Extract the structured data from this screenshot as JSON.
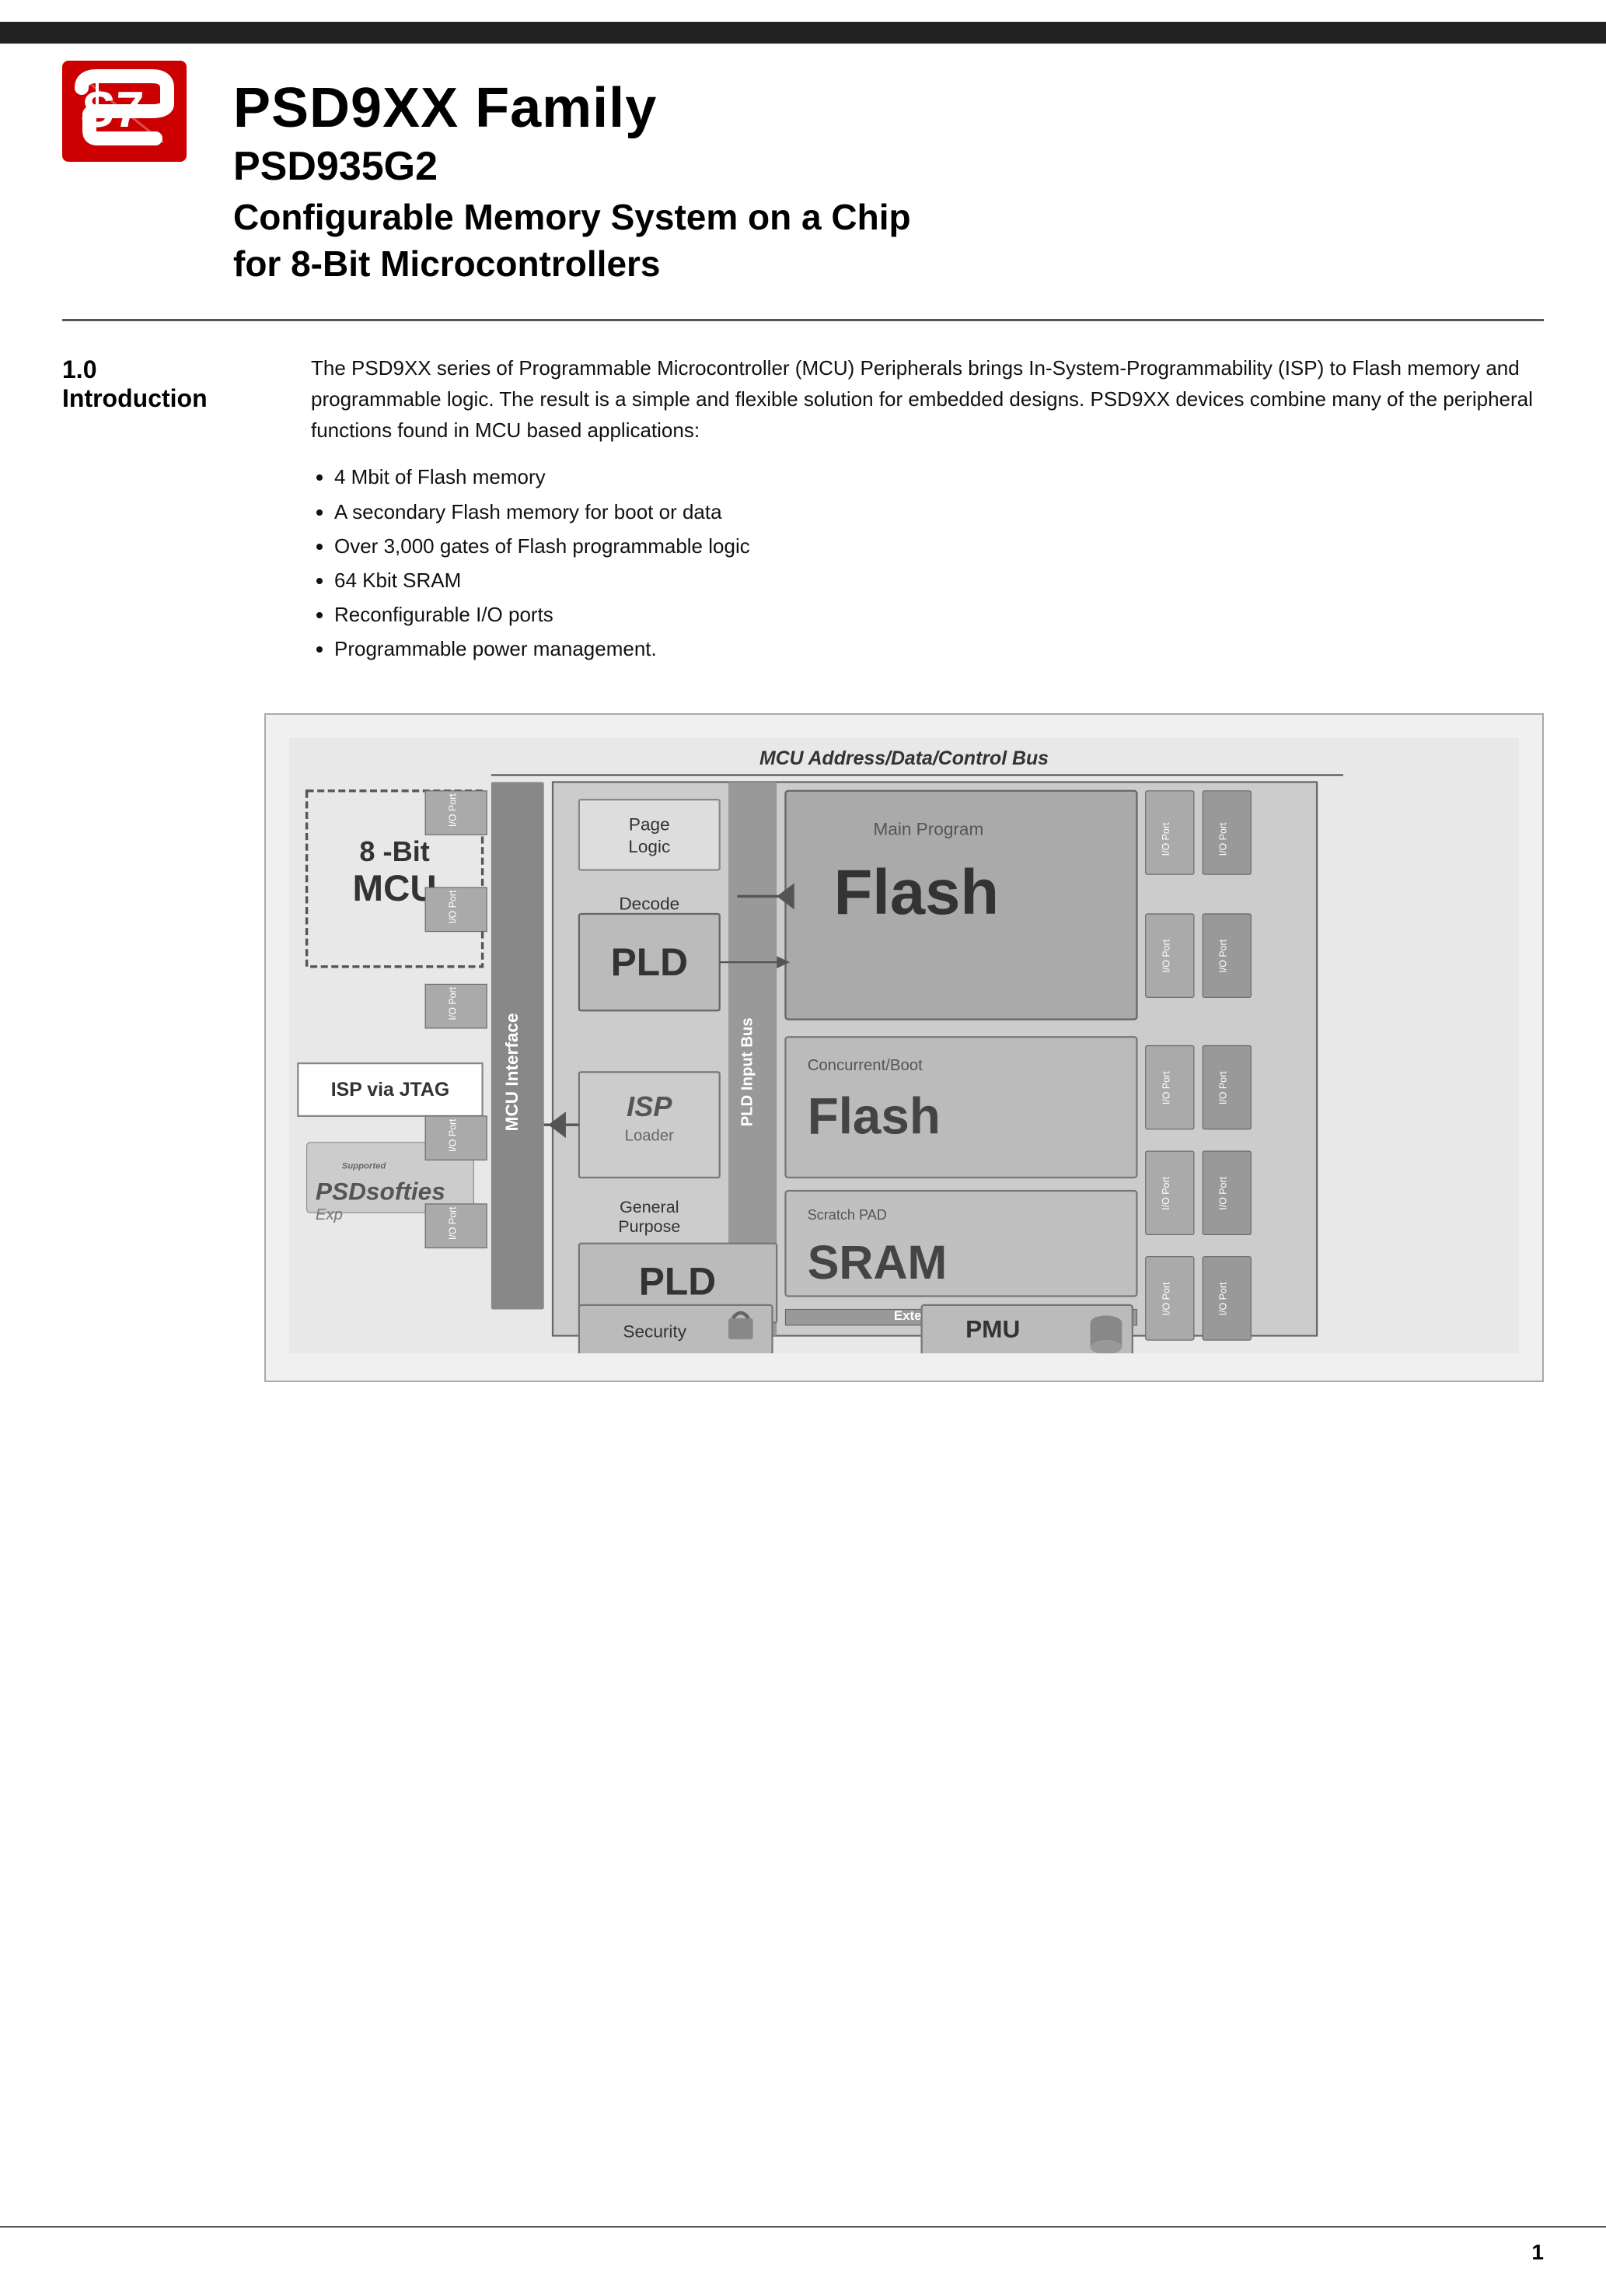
{
  "topbar": {
    "color": "#222"
  },
  "header": {
    "main_title": "PSD9XX Family",
    "sub_title": "PSD935G2",
    "desc_title": "Configurable Memory System on a Chip\nfor 8-Bit Microcontrollers"
  },
  "section": {
    "number": "1.0",
    "name": "Introduction",
    "body": "The PSD9XX series of Programmable Microcontroller (MCU) Peripherals brings In-System-Programmability (ISP) to Flash memory and programmable logic. The result is a simple and flexible solution for embedded designs. PSD9XX devices combine many of the peripheral functions found in MCU based applications:",
    "bullets": [
      "4 Mbit of Flash memory",
      "A secondary Flash memory for boot or data",
      "Over 3,000 gates of Flash programmable logic",
      "64 Kbit SRAM",
      "Reconfigurable I/O ports",
      "Programmable power management."
    ]
  },
  "diagram": {
    "title": "MCU Address/Data/Control Bus",
    "blocks": {
      "mcu": "8 -Bit\nMCU",
      "mcu_interface": "MCU Interface",
      "isp_jtag": "ISP via JTAG",
      "page_logic": "Page\nLogic",
      "decode": "Decode",
      "pld_decode": "PLD",
      "main_program": "Main Program",
      "flash_main": "Flash",
      "concurrent_boot": "Concurrent/Boot",
      "flash_boot": "Flash",
      "scratch_pad": "Scratch PAD",
      "sram": "SRAM",
      "isp_loader": "ISP\nLoader",
      "general_purpose": "General\nPurpose",
      "pld_general": "PLD",
      "external_chip_selects": "External Chip Selects",
      "pmu": "PMU",
      "security": "Security",
      "pld_input_bus": "PLD Input Bus",
      "io_port_labels": [
        "I/O Port",
        "I/O Port",
        "I/O Port",
        "I/O Port",
        "I/O Port",
        "I/O Port",
        "I/O Port",
        "I/O Port"
      ]
    }
  },
  "footer": {
    "page_number": "1"
  }
}
